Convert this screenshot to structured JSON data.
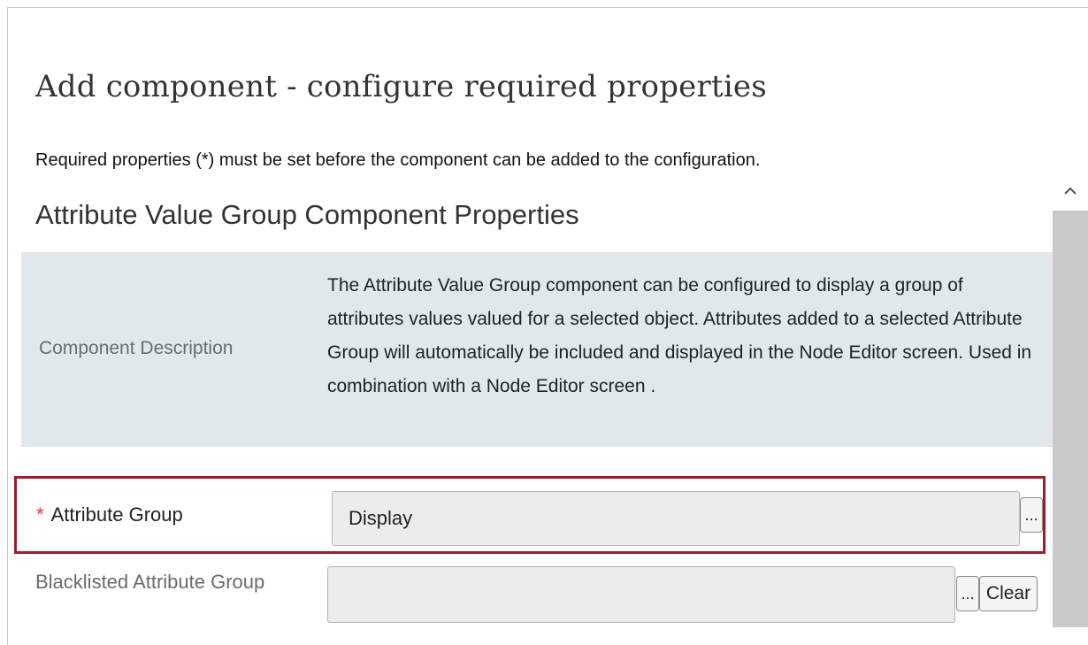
{
  "dialog": {
    "title": "Add component - configure required properties",
    "subtitle": "Required properties (*) must be set before the component can be added to the configuration."
  },
  "section": {
    "heading": "Attribute Value Group Component Properties",
    "description_label": "Component Description",
    "description_text": "The Attribute Value Group component can be configured to display a group of attributes values valued for a selected object. Attributes added to a selected Attribute Group will automatically be included and displayed in the Node Editor screen. Used in combination with a Node Editor screen ."
  },
  "fields": {
    "attribute_group": {
      "required_marker": "*",
      "label": "Attribute Group",
      "value": "Display",
      "browse_label": "..."
    },
    "blacklisted_group": {
      "label": "Blacklisted Attribute Group",
      "value": "",
      "browse_label": "...",
      "clear_label": "Clear"
    }
  },
  "colors": {
    "highlight_border": "#a11c2b",
    "required_star": "#d9343c",
    "description_bg": "#e1e8ec"
  },
  "icons": {
    "scroll_up": "chevron-up-icon"
  }
}
